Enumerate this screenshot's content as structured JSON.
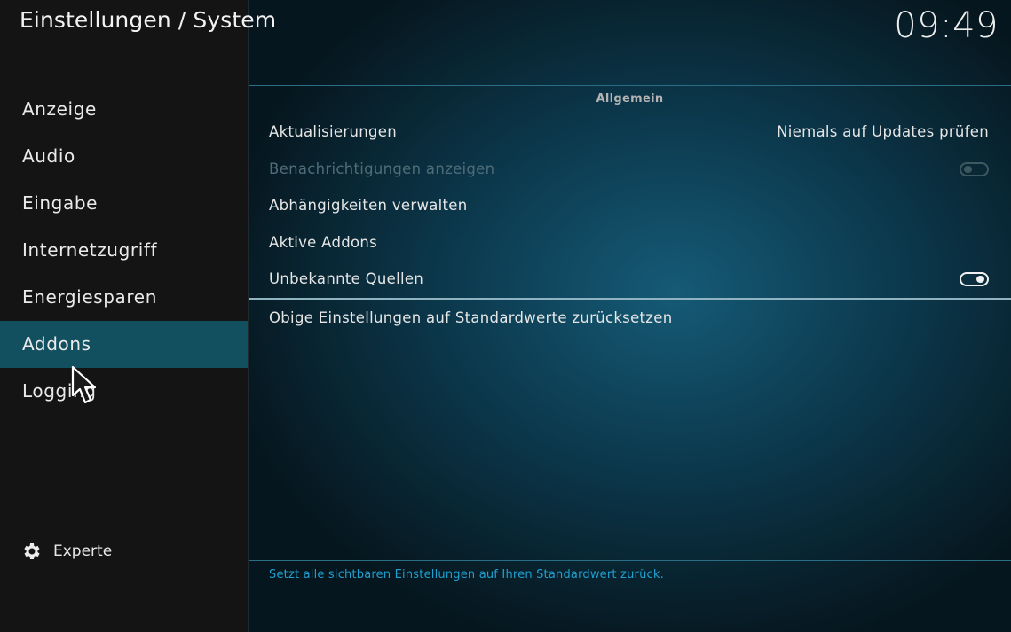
{
  "window": {
    "title": "Einstellungen / System",
    "clock": "09:49"
  },
  "sidebar": {
    "items": [
      {
        "label": "Anzeige"
      },
      {
        "label": "Audio"
      },
      {
        "label": "Eingabe"
      },
      {
        "label": "Internetzugriff"
      },
      {
        "label": "Energiesparen"
      },
      {
        "label": "Addons"
      },
      {
        "label": "Logging"
      }
    ],
    "active_item": "Addons",
    "settings_level": {
      "icon": "gear-icon",
      "label": "Experte"
    }
  },
  "content": {
    "group_title": "Allgemein",
    "settings": [
      {
        "label": "Aktualisierungen",
        "value": "Niemals auf Updates prüfen"
      },
      {
        "label": "Benachrichtigungen anzeigen",
        "toggle": "off",
        "disabled": true
      },
      {
        "label": "Abhängigkeiten verwalten"
      },
      {
        "label": "Aktive Addons"
      },
      {
        "label": "Unbekannte Quellen",
        "toggle": "on"
      }
    ],
    "reset_label": "Obige Einstellungen auf Standardwerte zurücksetzen",
    "help_text": "Setzt alle sichtbaren Einstellungen auf Ihren Standardwert zurück."
  },
  "colors": {
    "sidebar_active": "#12505f",
    "help_text": "#1fa0d0",
    "disabled_text": "#4f6d78"
  }
}
